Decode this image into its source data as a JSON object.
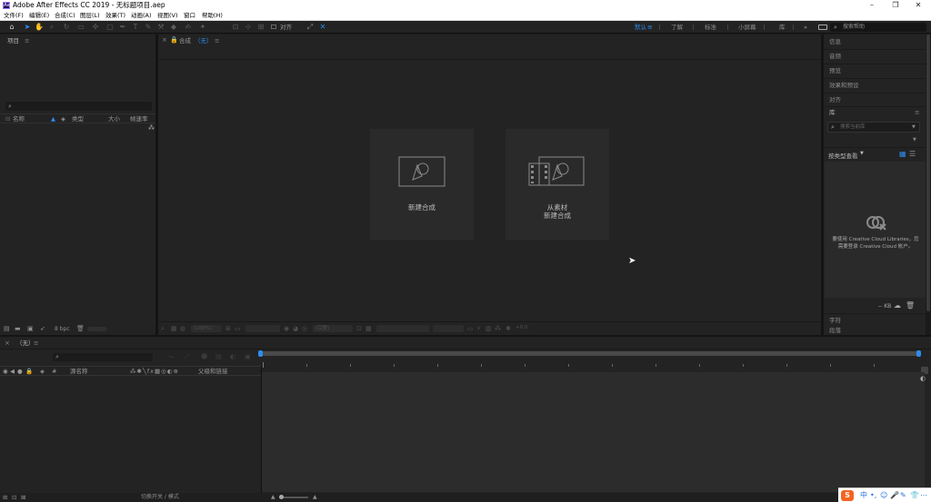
{
  "window": {
    "app_logo": "Ae",
    "title": "Adobe After Effects CC 2019 - 无标题项目.aep",
    "controls": [
      "minimize-icon",
      "maximize-icon",
      "close-icon"
    ]
  },
  "menu": [
    "文件(F)",
    "编辑(E)",
    "合成(C)",
    "图层(L)",
    "效果(T)",
    "动画(A)",
    "视图(V)",
    "窗口",
    "帮助(H)"
  ],
  "toolbar": {
    "snap_label": "对齐",
    "workspaces": [
      "默认",
      "了解",
      "标准",
      "小屏幕",
      "库"
    ],
    "workspace_more": "»",
    "search_placeholder": "搜索帮助"
  },
  "project_panel": {
    "title": "项目",
    "menu_icon": "≡",
    "search_icon": "⌕",
    "columns": {
      "name": "名称",
      "type": "类型",
      "size": "大小",
      "fps": "帧速率"
    },
    "bpc": "8 bpc"
  },
  "comp_panel": {
    "tab_label": "合成",
    "tab_value": "（无）",
    "menu_icon": "≡",
    "card_new": "新建合成",
    "card_from_footage_1": "从素材",
    "card_from_footage_2": "新建合成",
    "footer_zoom": "(100%)",
    "footer_res": "(完整)",
    "footer_offset": "+0.0"
  },
  "right_panel": {
    "items": [
      "信息",
      "音频",
      "预览",
      "效果和预设",
      "对齐"
    ],
    "library_title": "库",
    "library_menu_icon": "≡",
    "library_search_placeholder": "搜索当前库",
    "view_by_type": "按类型查看",
    "cc_message_1": "要使用 Creative Cloud Libraries，您",
    "cc_message_2": "需要登录 Creative Cloud 帐户。",
    "kb_label": "-- KB",
    "char_label": "字符",
    "para_label": "段落"
  },
  "timeline": {
    "tab_label": "（无）",
    "menu_icon": "≡",
    "search_icon": "⌕",
    "columns": {
      "source": "源名称",
      "parent": "父级和链接"
    },
    "footer_mode": "切换开关 / 模式"
  },
  "taskbar": {
    "ime_logo": "S",
    "items": [
      "中",
      "•,",
      "☺",
      "🎤",
      "✎",
      "👕",
      "⋯"
    ]
  },
  "colors": {
    "accent_blue": "#2d8ceb",
    "panel_bg": "#232323",
    "card_bg": "#2a2a2a",
    "ime_orange": "#f26522"
  }
}
